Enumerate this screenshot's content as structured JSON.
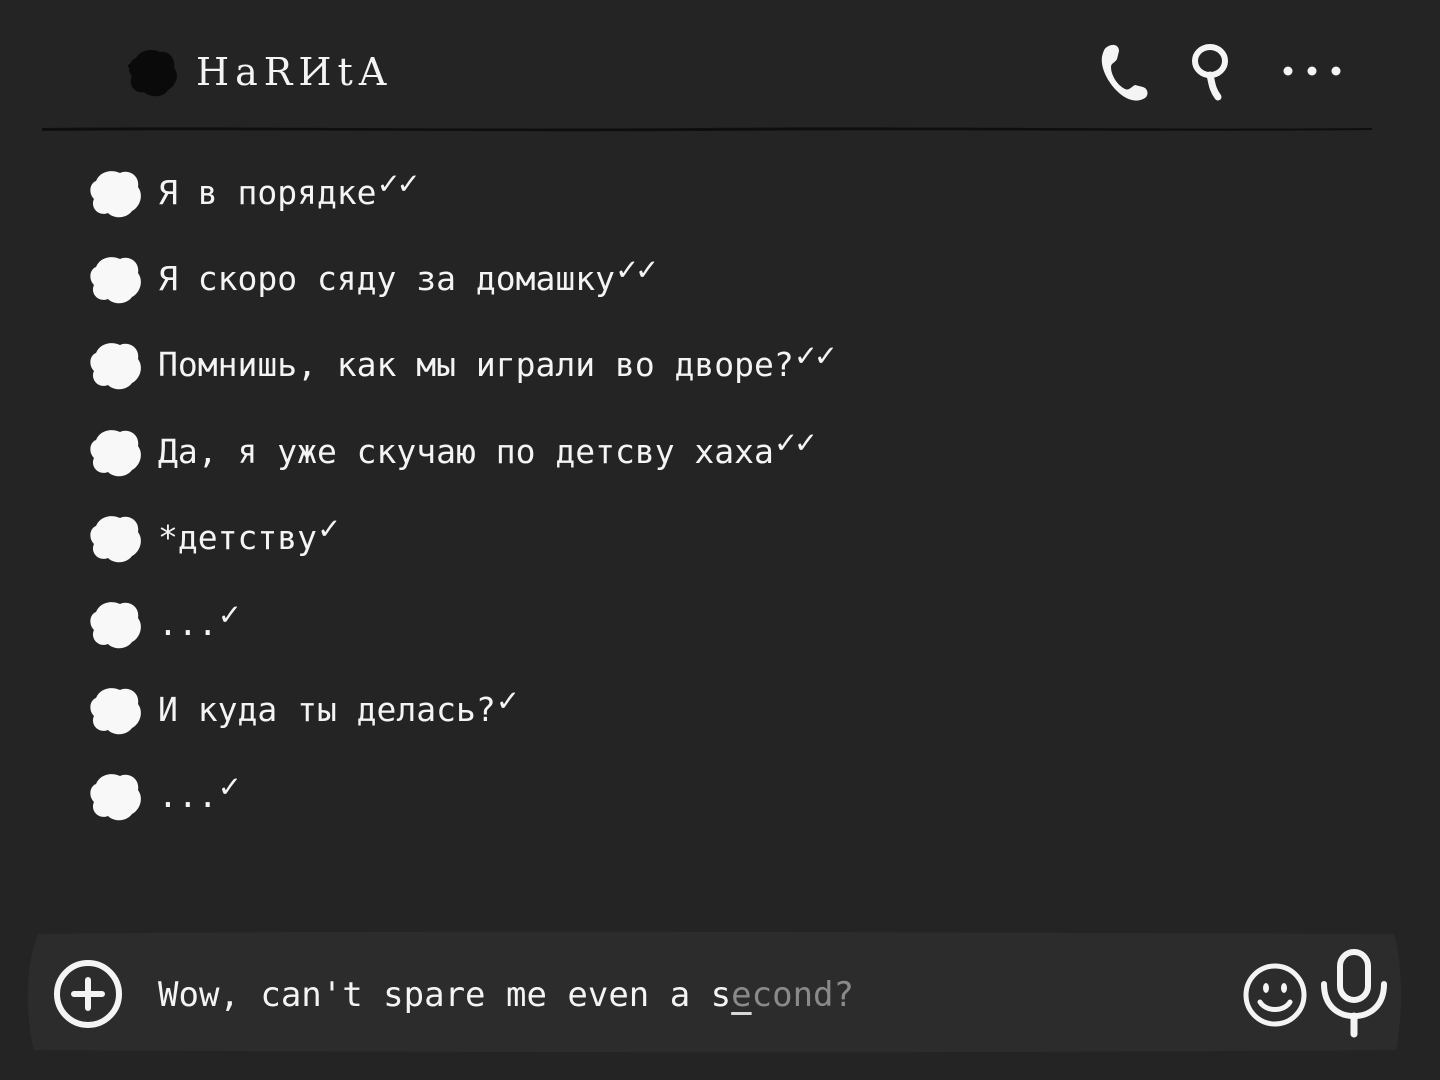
{
  "header": {
    "contact_name": "HaRИtA",
    "avatar_icon": "ink-blot-avatar-icon",
    "call_icon": "phone-icon",
    "search_icon": "search-icon",
    "more_icon": "more-dots-icon"
  },
  "messages": [
    {
      "text": "Я в порядке",
      "status": "✓✓"
    },
    {
      "text": "Я скоро сяду за домашку",
      "status": "✓✓"
    },
    {
      "text": "Помнишь, как мы играли во дворе?",
      "status": "✓✓"
    },
    {
      "text": "Да, я уже скучаю по детсву хаха",
      "status": "✓✓"
    },
    {
      "text": "*детству",
      "status": "✓"
    },
    {
      "text": "...",
      "status": "✓"
    },
    {
      "text": "И куда ты делась?",
      "status": "✓"
    },
    {
      "text": "...",
      "status": "✓"
    }
  ],
  "composer": {
    "typed_text": "Wow, can't spare me even a s",
    "caret_char": "e",
    "suggestion_text": "cond?",
    "attach_icon": "plus-circle-icon",
    "emoji_icon": "smiley-icon",
    "mic_icon": "microphone-icon"
  },
  "colors": {
    "background": "#242424",
    "text": "#f4f4f4",
    "muted_text": "#8a8a8a",
    "composer_background": "#2c2c2c",
    "divider": "#0e0e0e"
  }
}
